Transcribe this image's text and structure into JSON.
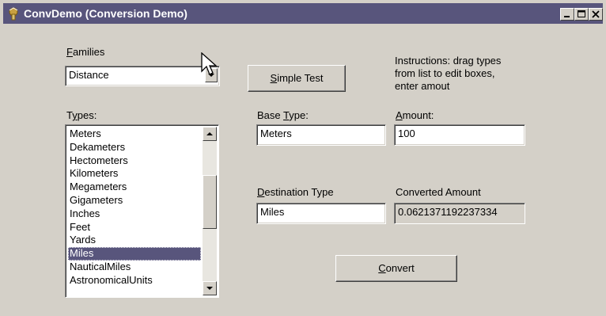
{
  "window": {
    "title": "ConvDemo (Conversion Demo)",
    "app_icon": "delphi-app-icon",
    "titlebar_color": "#58557c"
  },
  "families": {
    "label_first": "F",
    "label_rest": "amilies",
    "value": "Distance"
  },
  "simple_test": {
    "label_first": "S",
    "label_rest": "imple Test"
  },
  "instructions": {
    "line1": "Instructions: drag types",
    "line2": "from list to edit boxes,",
    "line3": "enter amout"
  },
  "types": {
    "label_pre": "T",
    "label_u": "y",
    "label_post": "pes:",
    "items": [
      "Meters",
      "Dekameters",
      "Hectometers",
      "Kilometers",
      "Megameters",
      "Gigameters",
      "Inches",
      "Feet",
      "Yards",
      "Miles",
      "NauticalMiles",
      "AstronomicalUnits"
    ],
    "selected": "Miles"
  },
  "base_type": {
    "label_pre": "Base ",
    "label_u": "T",
    "label_post": "ype:",
    "value": "Meters"
  },
  "amount": {
    "label_u": "A",
    "label_post": "mount:",
    "value": "100"
  },
  "destination_type": {
    "label_u": "D",
    "label_post": "estination Type",
    "value": "Miles"
  },
  "converted_amount": {
    "label": "Converted Amount",
    "value": "0.0621371192237334"
  },
  "convert": {
    "label_u": "C",
    "label_post": "onvert"
  }
}
